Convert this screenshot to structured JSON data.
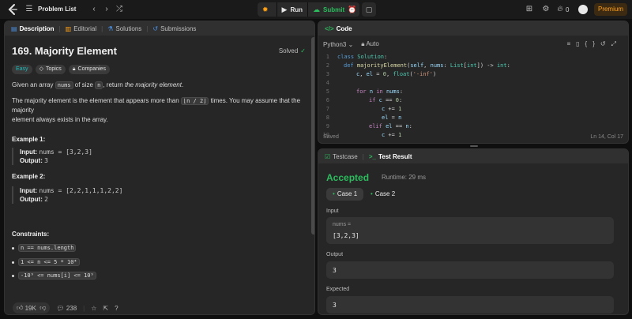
{
  "topbar": {
    "problem_list": "Problem List",
    "run": "Run",
    "submit": "Submit",
    "streak_count": "0",
    "premium": "Premium"
  },
  "description": {
    "tabs": [
      "Description",
      "Editorial",
      "Solutions",
      "Submissions"
    ],
    "title": "169. Majority Element",
    "solved": "Solved",
    "tags": [
      "Easy",
      "Topics",
      "Companies"
    ],
    "p1_a": "Given an array ",
    "p1_code1": "nums",
    "p1_b": " of size ",
    "p1_code2": "n",
    "p1_c": ", return ",
    "p1_em": "the majority element",
    "p1_d": ".",
    "p2_a": "The majority element is the element that appears more than ",
    "p2_code": "⌊n / 2⌋",
    "p2_b": " times. You may assume that the majority",
    "p2_line2": "element always exists in the array.",
    "ex1_title": "Example 1:",
    "ex1_input_label": "Input:",
    "ex1_input": "nums = [3,2,3]",
    "ex1_output_label": "Output:",
    "ex1_output": "3",
    "ex2_title": "Example 2:",
    "ex2_input_label": "Input:",
    "ex2_input": "nums = [2,2,1,1,1,2,2]",
    "ex2_output_label": "Output:",
    "ex2_output": "2",
    "constraints_title": "Constraints:",
    "c1": "n == nums.length",
    "c2": "1 <= n <= 5 * 10⁴",
    "c3": "-10⁹ <= nums[i] <= 10⁹",
    "likes": "19K",
    "comments": "238"
  },
  "code": {
    "tab": "Code",
    "language": "Python3",
    "auto": "Auto",
    "status": "Saved",
    "cursor": "Ln 14, Col 17",
    "line_numbers": [
      "1",
      "2",
      "3",
      "4",
      "5",
      "6",
      "7",
      "8",
      "9",
      "10"
    ]
  },
  "result": {
    "tabs": [
      "Testcase",
      "Test Result"
    ],
    "verdict": "Accepted",
    "runtime": "Runtime: 29 ms",
    "cases": [
      "Case 1",
      "Case 2"
    ],
    "input_label": "Input",
    "input_key": "nums =",
    "input_value": "[3,2,3]",
    "output_label": "Output",
    "output_value": "3",
    "expected_label": "Expected",
    "expected_value": "3"
  },
  "colors": {
    "accent_orange": "#ffa116",
    "green": "#2cbb5d",
    "easy_teal": "#1cbaba"
  }
}
